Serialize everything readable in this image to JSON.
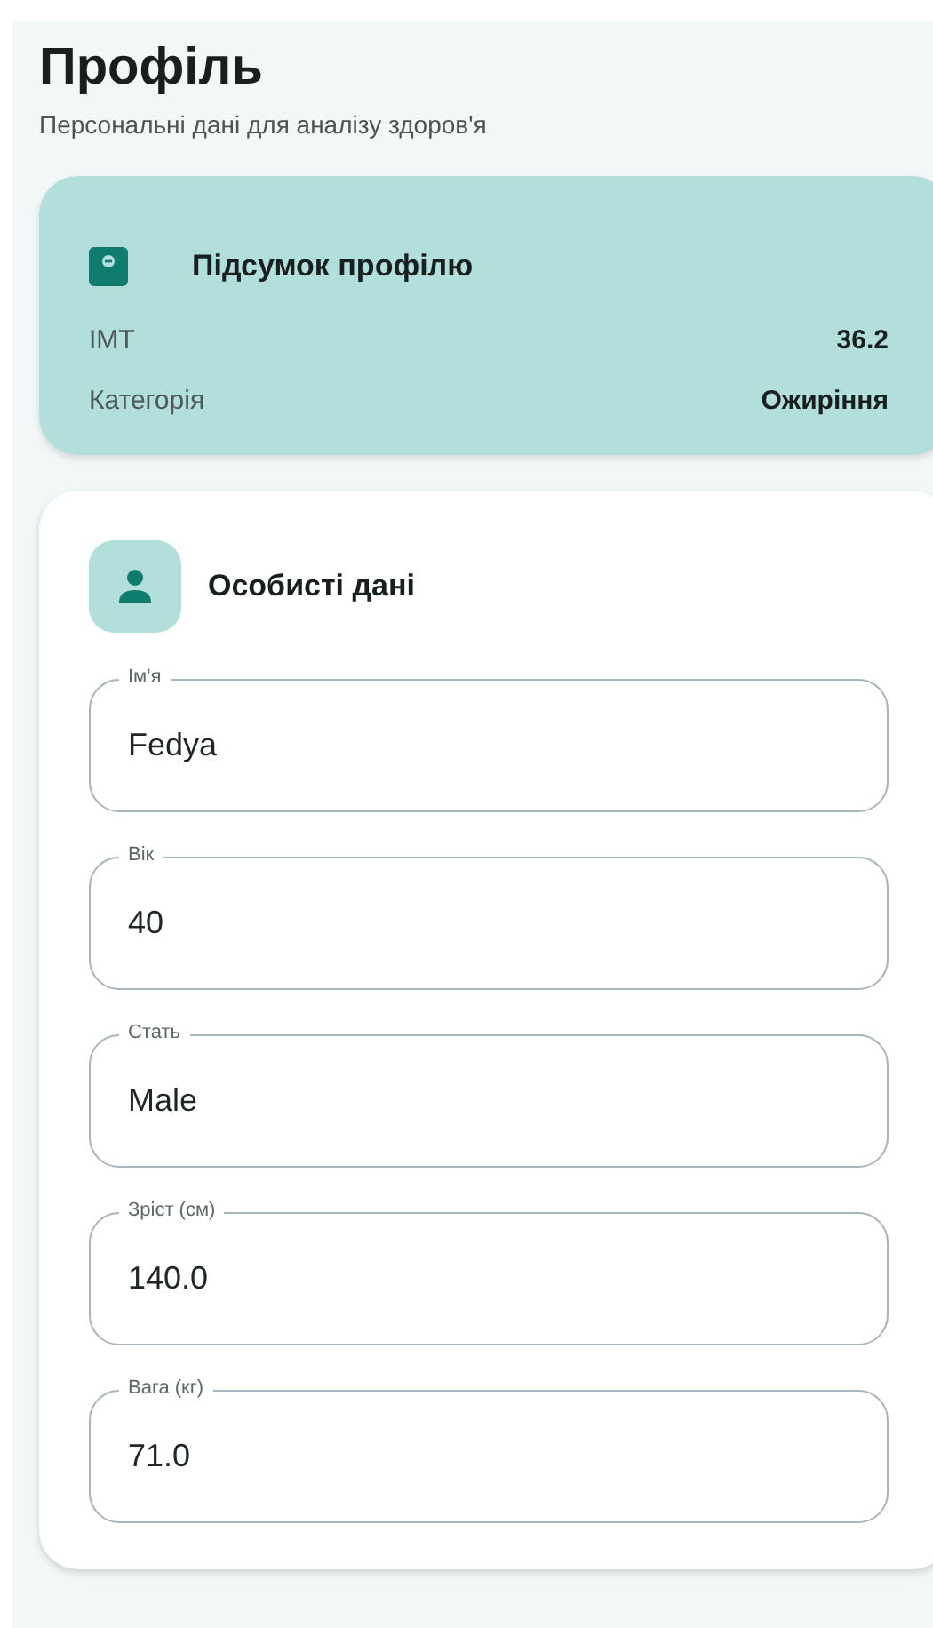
{
  "header": {
    "title": "Профіль",
    "subtitle": "Персональні дані для аналізу здоров'я"
  },
  "summary": {
    "title": "Підсумок профілю",
    "rows": [
      {
        "label": "ІМТ",
        "value": "36.2"
      },
      {
        "label": "Категорія",
        "value": "Ожиріння"
      }
    ]
  },
  "personal": {
    "title": "Особисті дані",
    "fields": [
      {
        "label": "Ім'я",
        "value": "Fedya"
      },
      {
        "label": "Вік",
        "value": "40"
      },
      {
        "label": "Стать",
        "value": "Male"
      },
      {
        "label": "Зріст (см)",
        "value": "140.0"
      },
      {
        "label": "Вага (кг)",
        "value": "71.0"
      }
    ]
  }
}
